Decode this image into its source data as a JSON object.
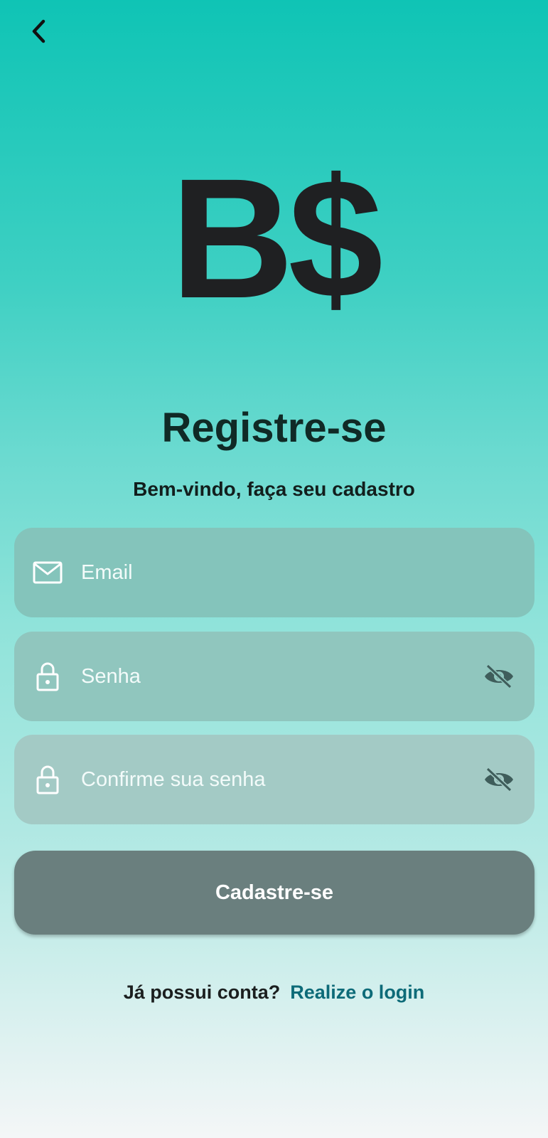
{
  "header": {
    "back_icon": "chevron-left-icon"
  },
  "logo": {
    "text": "B$"
  },
  "title": "Registre-se",
  "subtitle": "Bem-vindo, faça seu cadastro",
  "form": {
    "email": {
      "icon": "mail-icon",
      "placeholder": "Email"
    },
    "password": {
      "icon": "lock-icon",
      "placeholder": "Senha",
      "toggle_icon": "eye-off-icon"
    },
    "confirm_password": {
      "icon": "lock-icon",
      "placeholder": "Confirme sua senha",
      "toggle_icon": "eye-off-icon"
    },
    "submit_label": "Cadastre-se"
  },
  "footer": {
    "question": "Já possui conta?",
    "link_label": "Realize o login"
  },
  "colors": {
    "gradient_top": "#0fc4b5",
    "gradient_bottom": "#f4f6f7",
    "button": "#6a7f7e",
    "link": "#0d6b78",
    "text_dark": "#1f2022"
  }
}
